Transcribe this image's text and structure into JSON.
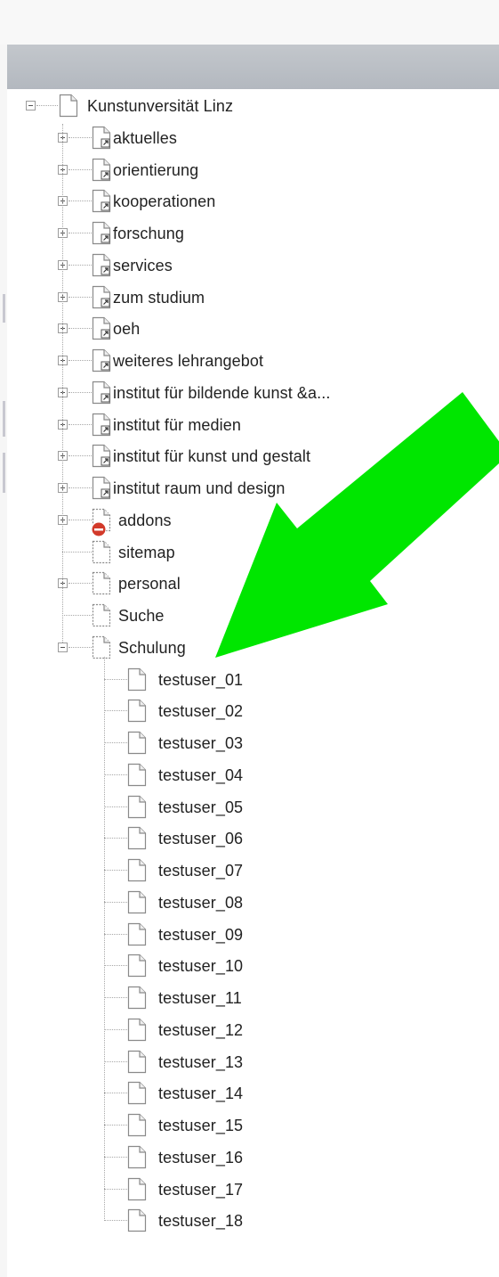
{
  "tree": {
    "root": {
      "label": "Kunstunversität Linz",
      "icon": "page-icon",
      "expanded": true
    },
    "items": [
      {
        "label": "aktuelles",
        "icon": "shortcut-page-icon",
        "toggle": "plus"
      },
      {
        "label": "orientierung",
        "icon": "shortcut-page-icon",
        "toggle": "plus"
      },
      {
        "label": "kooperationen",
        "icon": "shortcut-page-icon",
        "toggle": "plus"
      },
      {
        "label": "forschung",
        "icon": "shortcut-page-icon",
        "toggle": "plus"
      },
      {
        "label": "services",
        "icon": "shortcut-page-icon",
        "toggle": "plus"
      },
      {
        "label": "zum studium",
        "icon": "shortcut-page-icon",
        "toggle": "plus"
      },
      {
        "label": "oeh",
        "icon": "shortcut-page-icon",
        "toggle": "plus"
      },
      {
        "label": "weiteres lehrangebot",
        "icon": "shortcut-page-icon",
        "toggle": "plus"
      },
      {
        "label": "institut für bildende kunst &a...",
        "icon": "shortcut-page-icon",
        "toggle": "plus"
      },
      {
        "label": "institut für medien",
        "icon": "shortcut-page-icon",
        "toggle": "plus"
      },
      {
        "label": "institut für kunst und gestalt",
        "icon": "shortcut-page-icon",
        "toggle": "plus"
      },
      {
        "label": "institut raum und design",
        "icon": "shortcut-page-icon",
        "toggle": "plus"
      },
      {
        "label": "addons",
        "icon": "hidden-page-icon",
        "toggle": "plus"
      },
      {
        "label": "sitemap",
        "icon": "hidden-page-icon",
        "toggle": "none"
      },
      {
        "label": "personal",
        "icon": "hidden-page-icon",
        "toggle": "plus"
      },
      {
        "label": "Suche",
        "icon": "hidden-page-icon",
        "toggle": "none"
      },
      {
        "label": "Schulung",
        "icon": "hidden-page-icon",
        "toggle": "minus",
        "children": [
          {
            "label": "testuser_01"
          },
          {
            "label": "testuser_02"
          },
          {
            "label": "testuser_03"
          },
          {
            "label": "testuser_04"
          },
          {
            "label": "testuser_05"
          },
          {
            "label": "testuser_06"
          },
          {
            "label": "testuser_07"
          },
          {
            "label": "testuser_08"
          },
          {
            "label": "testuser_09"
          },
          {
            "label": "testuser_10"
          },
          {
            "label": "testuser_11"
          },
          {
            "label": "testuser_12"
          },
          {
            "label": "testuser_13"
          },
          {
            "label": "testuser_14"
          },
          {
            "label": "testuser_15"
          },
          {
            "label": "testuser_16"
          },
          {
            "label": "testuser_17"
          },
          {
            "label": "testuser_18"
          }
        ]
      }
    ]
  },
  "annotation": {
    "icon": "green-arrow-icon",
    "color": "#00e600",
    "points_to": "Schulung"
  },
  "colors": {
    "header": "#b9bdc3",
    "tree_line": "#a8a8a8",
    "text": "#222222",
    "restricted_badge": "#d23a2a"
  }
}
